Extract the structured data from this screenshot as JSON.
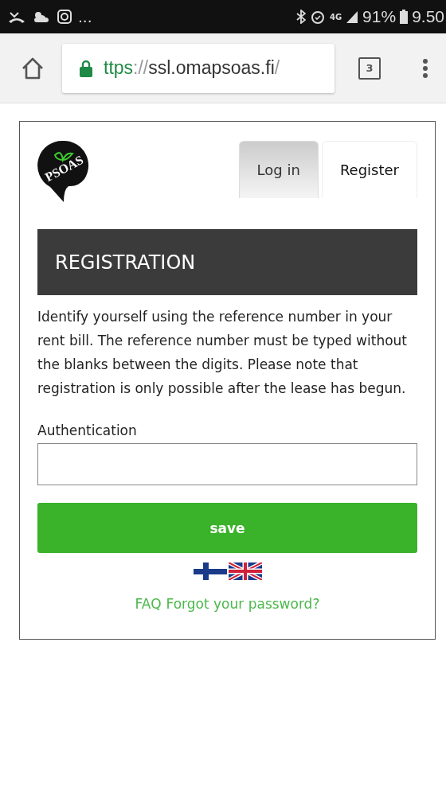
{
  "status_bar": {
    "more": "...",
    "network": "4G",
    "battery": "91%",
    "time": "9.50"
  },
  "browser": {
    "url": {
      "scheme": "ttps",
      "separator": "://",
      "host": "ssl.omapsoas.fi",
      "path": "/"
    },
    "tab_count": "3"
  },
  "logo": {
    "text": "PSOAS"
  },
  "tabs": [
    {
      "label": "Log in",
      "selected": false
    },
    {
      "label": "Register",
      "selected": true
    }
  ],
  "heading": "REGISTRATION",
  "intro": "Identify yourself using the reference number in your rent bill. The reference number must be typed without the blanks between the digits. Please note that registration is only possible after the lease has begun.",
  "field": {
    "label": "Authentication"
  },
  "save_button": "save",
  "links": [
    "FAQ",
    "Forgot your password?"
  ]
}
